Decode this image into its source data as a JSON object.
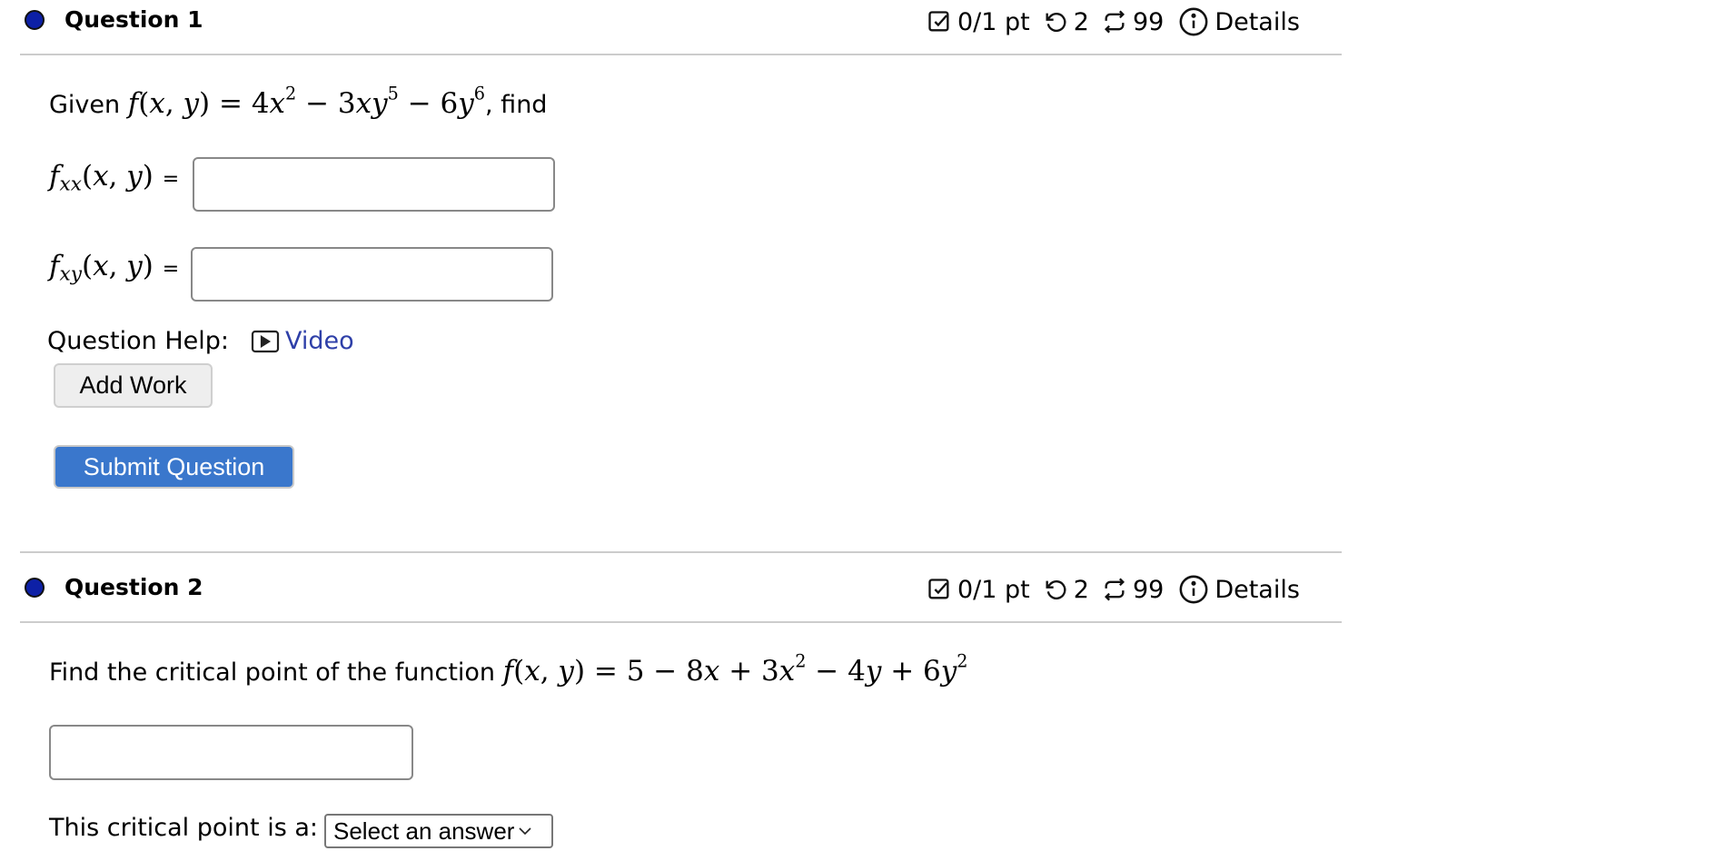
{
  "questions": [
    {
      "title": "Question 1",
      "score": "0/1 pt",
      "retries": "2",
      "attempts": "99",
      "details_label": "Details",
      "prompt_prefix": "Given",
      "prompt_suffix": ", find",
      "function_lhs": "f(x, y)",
      "function_rhs": "4x² − 3xy⁵ − 6y⁶",
      "parts": [
        {
          "label": "f_xx(x, y) =",
          "value": "",
          "placeholder": ""
        },
        {
          "label": "f_xy(x, y) =",
          "value": "",
          "placeholder": ""
        }
      ],
      "help_label": "Question Help:",
      "help_link": "Video",
      "add_work_label": "Add Work",
      "submit_label": "Submit Question"
    },
    {
      "title": "Question 2",
      "score": "0/1 pt",
      "retries": "2",
      "attempts": "99",
      "details_label": "Details",
      "prompt_prefix": "Find the critical point of the function",
      "function_lhs": "f(x, y)",
      "function_rhs": "5 − 8x + 3x² − 4y + 6y²",
      "answer_value": "",
      "classify_label": "This critical point is a:",
      "select_value": "Select an answer"
    }
  ],
  "icons": {
    "score": "checkbox-icon",
    "retries": "undo-icon",
    "attempts": "repeat-icon",
    "details": "info-icon",
    "video": "video-icon"
  },
  "colors": {
    "status_dot": "#0d20a6",
    "submit_bg": "#3a77cc",
    "link": "#2e3fa8",
    "divider": "#cccccc"
  }
}
